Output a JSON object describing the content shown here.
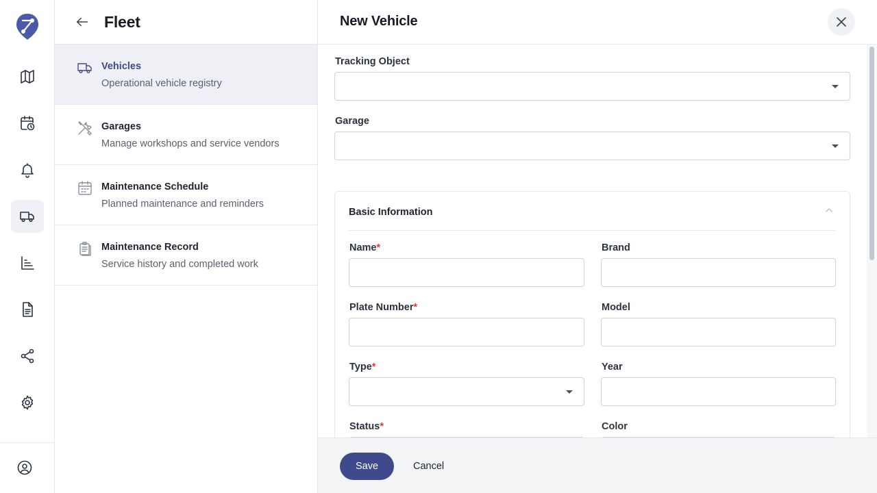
{
  "rail": {
    "logo": "route-pin-logo",
    "items": [
      {
        "icon": "map-icon"
      },
      {
        "icon": "calendar-clock-icon"
      },
      {
        "icon": "bell-icon"
      },
      {
        "icon": "truck-icon",
        "active": true
      },
      {
        "icon": "bar-chart-icon"
      },
      {
        "icon": "document-icon"
      },
      {
        "icon": "share-icon"
      },
      {
        "icon": "gear-icon"
      }
    ],
    "profile_icon": "user-circle-icon"
  },
  "panel": {
    "title": "Fleet",
    "items": [
      {
        "title": "Vehicles",
        "subtitle": "Operational vehicle registry",
        "icon": "truck-icon",
        "active": true
      },
      {
        "title": "Garages",
        "subtitle": "Manage workshops and service vendors",
        "icon": "tools-icon"
      },
      {
        "title": "Maintenance Schedule",
        "subtitle": "Planned maintenance and reminders",
        "icon": "calendar-icon"
      },
      {
        "title": "Maintenance Record",
        "subtitle": "Service history and completed work",
        "icon": "clipboard-icon"
      }
    ]
  },
  "drawer": {
    "title": "New Vehicle",
    "tracking_object": {
      "label": "Tracking Object",
      "value": ""
    },
    "garage": {
      "label": "Garage",
      "value": ""
    },
    "basic_info": {
      "title": "Basic Information",
      "required_mark": "*",
      "name": {
        "label": "Name",
        "value": ""
      },
      "brand": {
        "label": "Brand",
        "value": ""
      },
      "plate_number": {
        "label": "Plate Number",
        "value": ""
      },
      "model": {
        "label": "Model",
        "value": ""
      },
      "type": {
        "label": "Type",
        "value": ""
      },
      "year": {
        "label": "Year",
        "value": ""
      },
      "status": {
        "label": "Status"
      },
      "color": {
        "label": "Color"
      }
    },
    "footer": {
      "save_label": "Save",
      "cancel_label": "Cancel"
    }
  },
  "colors": {
    "accent": "#3f4a8c",
    "required": "#e0383e",
    "logo": "#4a5aa8"
  }
}
